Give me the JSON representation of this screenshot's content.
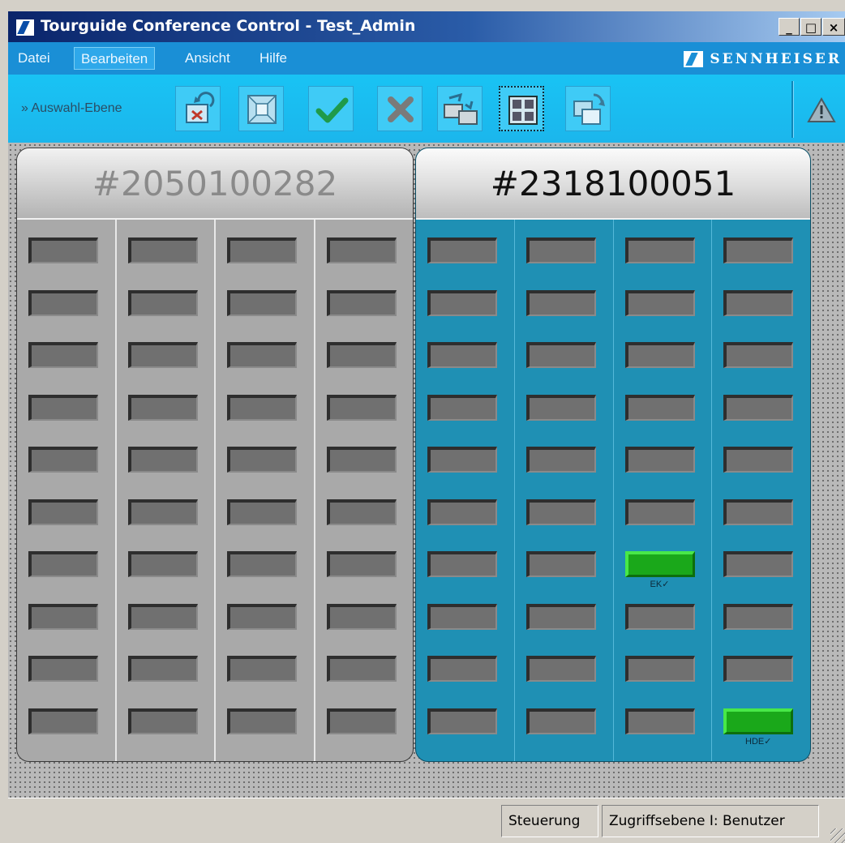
{
  "window": {
    "title": "Tourguide Conference Control - Test_Admin",
    "controls": {
      "minimize": "_",
      "maximize": "□",
      "close": "×"
    }
  },
  "menu": {
    "items": [
      {
        "label": "Datei",
        "active": false
      },
      {
        "label": "Bearbeiten",
        "active": true
      },
      {
        "label": "Ansicht",
        "active": false
      },
      {
        "label": "Hilfe",
        "active": false
      }
    ],
    "brand": "SENNHEISER"
  },
  "toolbar": {
    "label": "» Auswahl-Ebene",
    "buttons": [
      {
        "icon": "reset-device-icon"
      },
      {
        "icon": "select-all-grid-icon"
      },
      {
        "icon": "confirm-check-icon"
      },
      {
        "icon": "cancel-x-icon"
      },
      {
        "icon": "sync-devices-icon"
      },
      {
        "icon": "grid-view-icon"
      },
      {
        "icon": "window-restore-icon"
      }
    ],
    "warning_icon": "warning-triangle-icon"
  },
  "panels": [
    {
      "id": "#2050100282",
      "active": false,
      "columns": 4,
      "rows": 10,
      "active_slots": []
    },
    {
      "id": "#2318100051",
      "active": true,
      "columns": 4,
      "rows": 10,
      "active_slots": [
        {
          "col": 3,
          "row": 7,
          "label": "EK✓"
        },
        {
          "col": 4,
          "row": 10,
          "label": "HDE✓"
        }
      ]
    }
  ],
  "statusbar": {
    "mode": "Steuerung",
    "access_level": "Zugriffsebene I: Benutzer"
  },
  "colors": {
    "title_gradient_start": "#0a246a",
    "menu_background": "#1a8fd6",
    "toolbar_background": "#19c3f4",
    "active_panel": "#1f90b4",
    "inactive_panel": "#a9a9a9",
    "slot_active": "#1aa81a",
    "slot_idle": "#707070"
  }
}
